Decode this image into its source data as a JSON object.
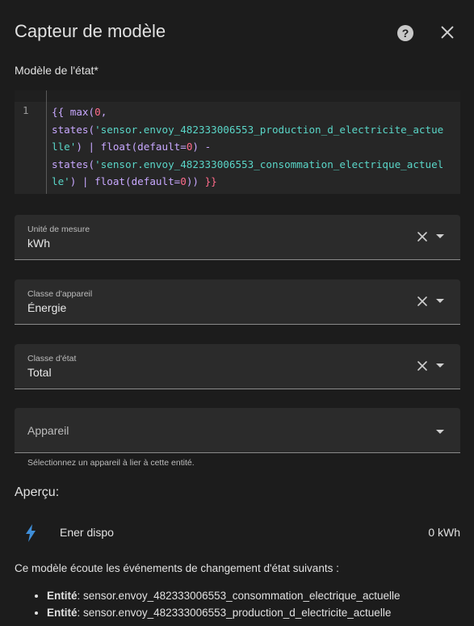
{
  "dialog": {
    "title": "Capteur de modèle",
    "help_icon": "help-circle-icon",
    "close_icon": "close-icon"
  },
  "template": {
    "label": "Modèle de l'état*",
    "line_number": "1",
    "lines": [
      "{{ max(0,",
      "states('sensor.envoy_482333006553_production_d_electricite_actue",
      "lle') | float(default=0) -",
      "states('sensor.envoy_482333006553_consommation_electrique_actuel",
      "le') | float(default=0)) }}"
    ]
  },
  "fields": {
    "unit": {
      "label": "Unité de mesure",
      "value": "kWh"
    },
    "device_class": {
      "label": "Classe d'appareil",
      "value": "Énergie"
    },
    "state_class": {
      "label": "Classe d'état",
      "value": "Total"
    },
    "device": {
      "placeholder": "Appareil",
      "helper": "Sélectionnez un appareil à lier à cette entité."
    }
  },
  "preview": {
    "title": "Aperçu:",
    "icon": "flash-icon",
    "entity_name": "Ener dispo",
    "entity_value": "0 kWh",
    "listen_text": "Ce modèle écoute les événements de changement d'état suivants :",
    "entity_prefix": "Entité",
    "listeners": [
      "sensor.envoy_482333006553_consommation_electrique_actuelle",
      "sensor.envoy_482333006553_production_d_electricite_actuelle"
    ]
  },
  "colors": {
    "background": "#1c1c1c",
    "field_background": "#2b2b2b",
    "code_background": "#262626",
    "icon_blue": "#3f8ed8"
  }
}
